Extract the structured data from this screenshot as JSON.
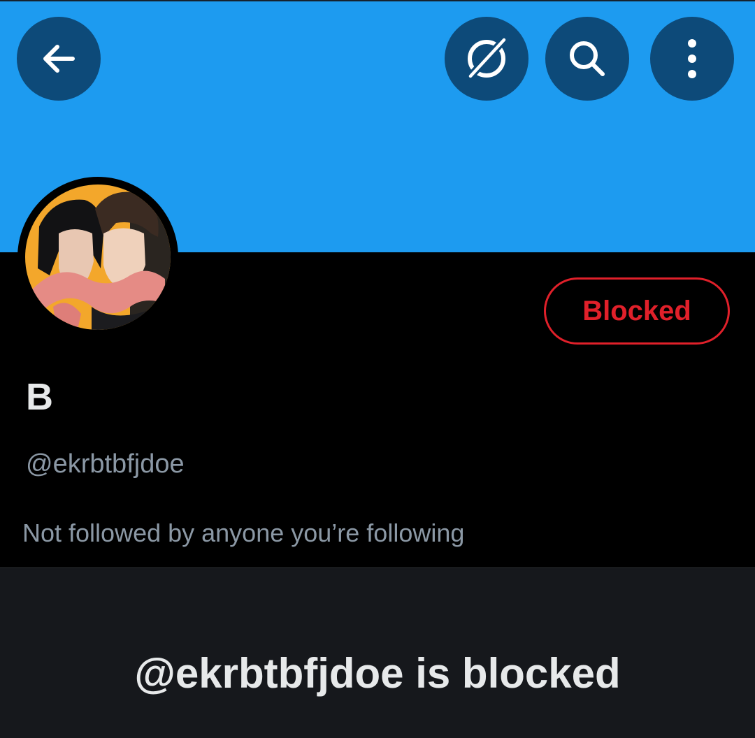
{
  "colors": {
    "banner": "#1d9bf0",
    "button_bg": "#0d4a79",
    "blocked_red": "#e0202a",
    "text_primary": "#e7e9ea",
    "text_secondary": "#8b98a5",
    "lower_panel_bg": "#16181c"
  },
  "header": {
    "back_icon": "arrow-left-icon",
    "grok_icon": "grok-icon",
    "search_icon": "search-icon",
    "more_icon": "more-vertical-icon"
  },
  "profile": {
    "display_name": "B",
    "handle": "@ekrbtbfjdoe",
    "follow_info": "Not followed by anyone you’re following",
    "blocked_button_label": "Blocked",
    "blocked_heading": "@ekrbtbfjdoe is blocked"
  }
}
